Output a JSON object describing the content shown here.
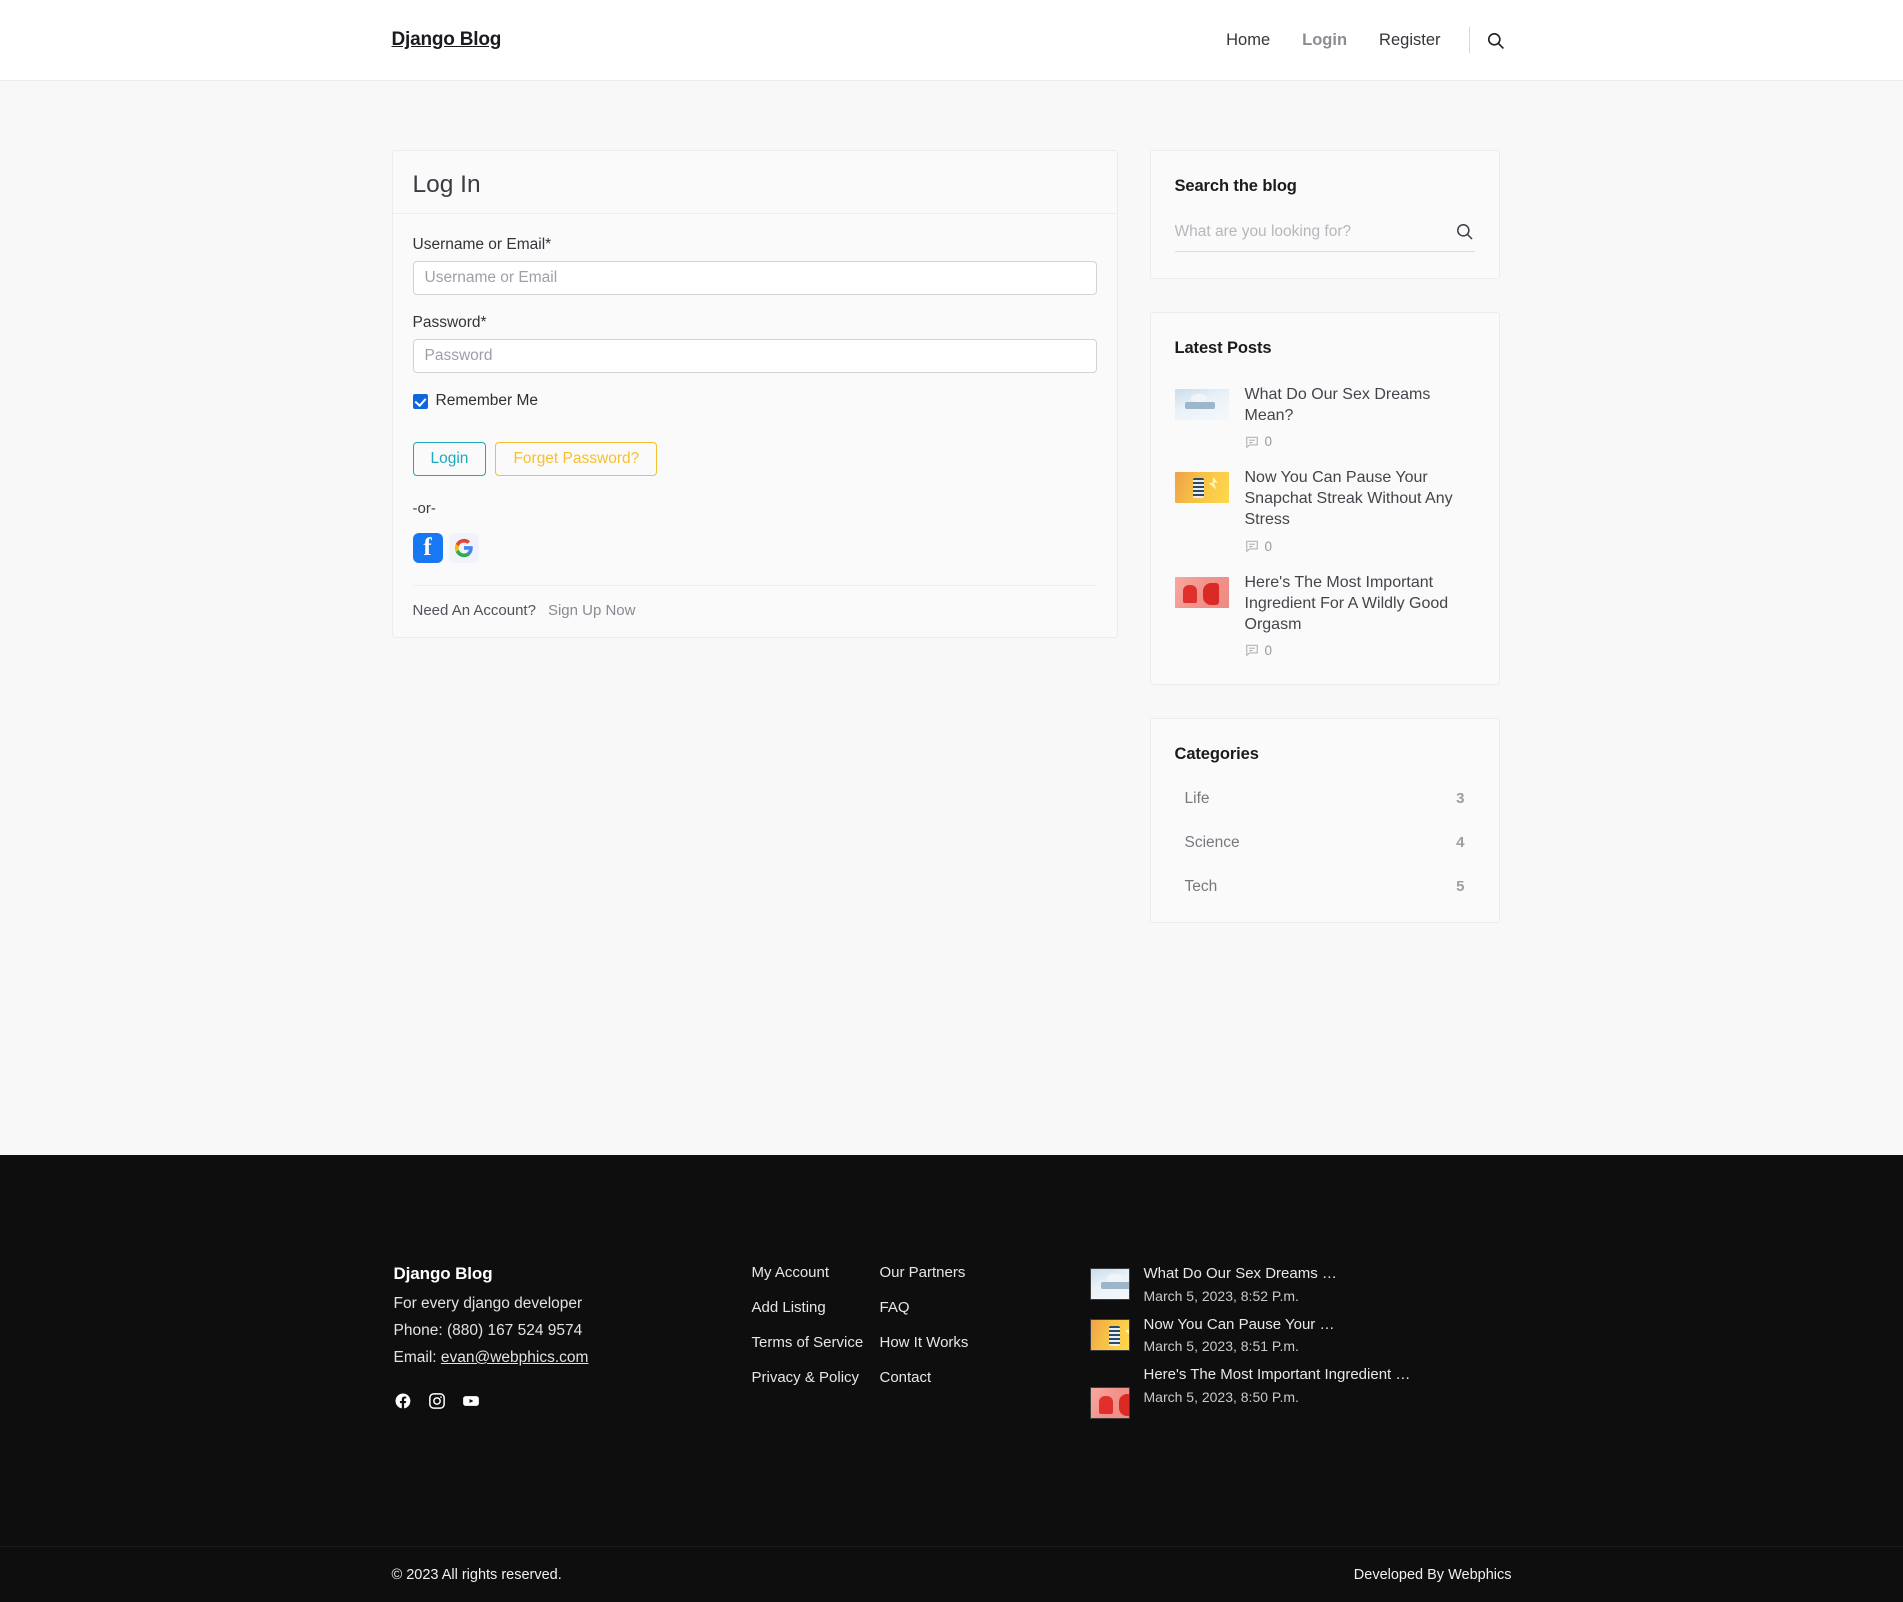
{
  "header": {
    "brand": "Django Blog",
    "nav": [
      {
        "label": "Home",
        "active": false
      },
      {
        "label": "Login",
        "active": true
      },
      {
        "label": "Register",
        "active": false
      }
    ],
    "search_icon": "search-icon"
  },
  "login": {
    "title": "Log In",
    "username_label": "Username or Email*",
    "username_placeholder": "Username or Email",
    "username_value": "",
    "password_label": "Password*",
    "password_placeholder": "Password",
    "password_value": "",
    "remember_label": "Remember Me",
    "remember_checked": true,
    "login_button": "Login",
    "forget_button": "Forget Password?",
    "or_text": "-or-",
    "social": [
      {
        "name": "facebook-login-icon",
        "label": "f"
      },
      {
        "name": "google-login-icon",
        "label": "G"
      }
    ],
    "need_account_text": "Need An Account?",
    "signup_link": "Sign Up Now",
    "colors": {
      "login_accent": "#21a8bd",
      "forget_accent": "#f5c12e",
      "checkbox": "#1166dd"
    }
  },
  "sidebar": {
    "search_widget": {
      "title": "Search the blog",
      "placeholder": "What are you looking for?",
      "value": ""
    },
    "latest_posts": {
      "title": "Latest Posts",
      "items": [
        {
          "title": "What Do Our Sex Dreams Mean?",
          "comments": "0"
        },
        {
          "title": "Now You Can Pause Your Snapchat Streak Without Any Stress",
          "comments": "0"
        },
        {
          "title": "Here's The Most Important Ingredient For A Wildly Good Orgasm",
          "comments": "0"
        }
      ]
    },
    "categories": {
      "title": "Categories",
      "items": [
        {
          "name": "Life",
          "count": "3"
        },
        {
          "name": "Science",
          "count": "4"
        },
        {
          "name": "Tech",
          "count": "5"
        }
      ]
    }
  },
  "footer": {
    "brand": {
      "title": "Django Blog",
      "tagline": "For every django developer",
      "phone_label": "Phone:",
      "phone": "(880) 167 524 9574",
      "email_label": "Email:",
      "email": "evan@webphics.com"
    },
    "social": [
      {
        "name": "facebook-icon"
      },
      {
        "name": "instagram-icon"
      },
      {
        "name": "youtube-icon"
      }
    ],
    "links_col1": [
      "My Account",
      "Add Listing",
      "Terms of Service",
      "Privacy & Policy"
    ],
    "links_col2": [
      "Our Partners",
      "FAQ",
      "How It Works",
      "Contact"
    ],
    "recent_posts": [
      {
        "title": "What Do Our Sex Dreams …",
        "date": "March 5, 2023, 8:52 P.m."
      },
      {
        "title": "Now You Can Pause Your …",
        "date": "March 5, 2023, 8:51 P.m."
      },
      {
        "title": "Here's The Most Important Ingredient …",
        "date": "March 5, 2023, 8:50 P.m."
      }
    ],
    "copyright": "© 2023 All rights reserved.",
    "developed_by": "Developed By Webphics"
  }
}
